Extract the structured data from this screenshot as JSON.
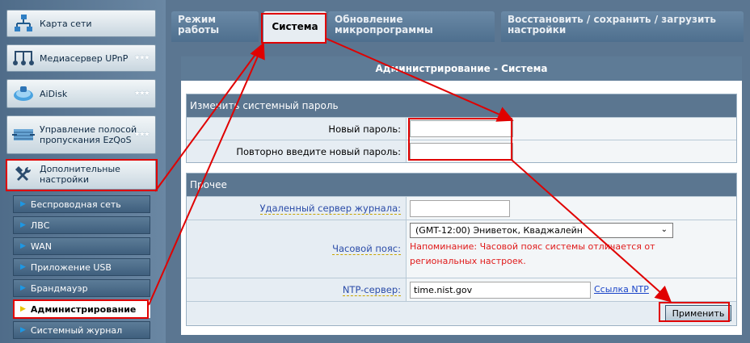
{
  "sidebar": {
    "cards": [
      {
        "label": "Карта сети",
        "icon": "network-map-icon",
        "stars": false
      },
      {
        "label": "Медиасервер UPnP",
        "icon": "media-server-icon",
        "stars": true
      },
      {
        "label": "AiDisk",
        "icon": "aidisk-icon",
        "stars": true
      },
      {
        "label": "Управление полосой пропускания EzQoS",
        "icon": "qos-icon",
        "stars": true
      },
      {
        "label": "Дополнительные настройки",
        "icon": "tools-icon",
        "stars": false
      }
    ],
    "subitems": [
      {
        "label": "Беспроводная сеть"
      },
      {
        "label": "ЛВС"
      },
      {
        "label": "WAN"
      },
      {
        "label": "Приложение USB"
      },
      {
        "label": "Брандмауэр"
      },
      {
        "label": "Администрирование",
        "active": true
      },
      {
        "label": "Системный журнал"
      }
    ]
  },
  "tabs": [
    {
      "label": "Режим работы"
    },
    {
      "label": "Система",
      "active": true
    },
    {
      "label": "Обновление микропрограммы"
    },
    {
      "label": "Восстановить / сохранить / загрузить настройки"
    }
  ],
  "panel": {
    "title": "Администрирование - Система",
    "password_section": {
      "title": "Изменить системный пароль",
      "new_password_label": "Новый пароль:",
      "new_password_value": "",
      "confirm_password_label": "Повторно введите новый пароль:",
      "confirm_password_value": ""
    },
    "misc_section": {
      "title": "Прочее",
      "log_server_label": "Удаленный сервер журнала:",
      "log_server_value": "",
      "timezone_label": "Часовой пояс:",
      "timezone_value": "(GMT-12:00) Эниветок, Кваджалейн",
      "timezone_warning": "Напоминание: Часовой пояс системы отличается от региональных настроек.",
      "ntp_label": "NTP-сервер:",
      "ntp_value": "time.nist.gov",
      "ntp_link": "Ссылка NTP",
      "apply_label": "Применить"
    }
  },
  "colors": {
    "annotation": "#e00000",
    "warning": "#e01a1a",
    "header": "#5b7690"
  }
}
